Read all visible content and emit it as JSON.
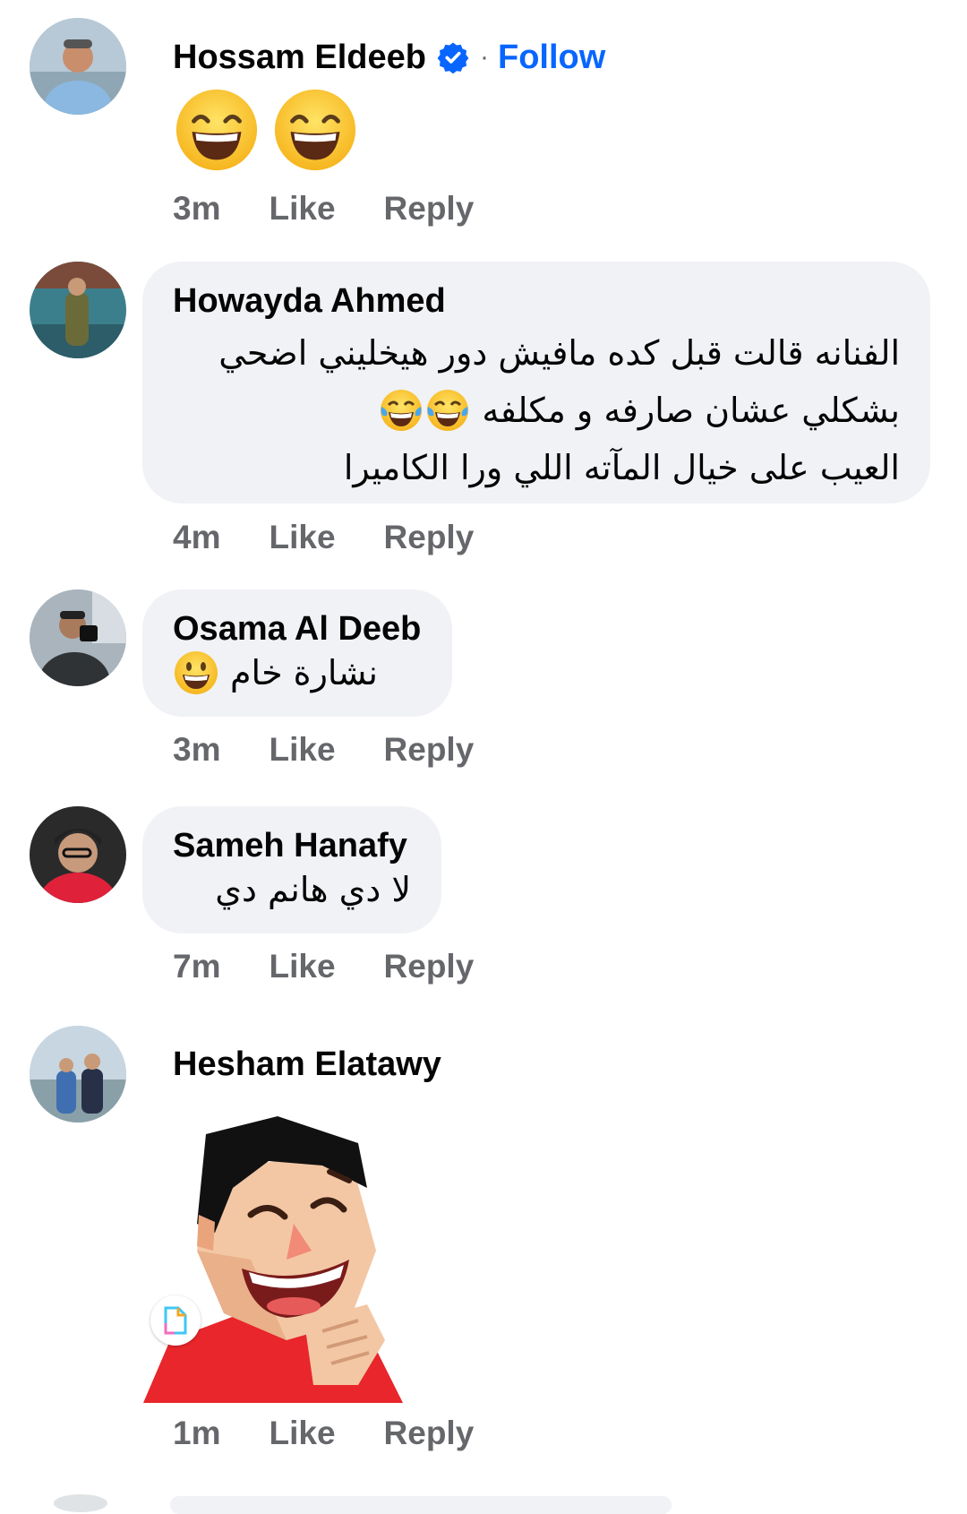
{
  "comments": [
    {
      "author": "Hossam Eldeeb",
      "verified": true,
      "follow_label": "Follow",
      "separator": "·",
      "content_emoji": [
        "grinning-smiling-eyes-emoji",
        "grinning-smiling-eyes-emoji"
      ],
      "time": "3m",
      "like": "Like",
      "reply": "Reply"
    },
    {
      "author": "Howayda Ahmed",
      "lines": [
        "الفنانه قالت قبل كده مافيش دور هيخليني اضحي",
        "بشكلي  عشان صارفه و مكلفه",
        "العيب على خيال المآته اللي ورا الكاميرا"
      ],
      "line_emoji": [
        "tears-of-joy-emoji",
        "tears-of-joy-emoji"
      ],
      "time": "4m",
      "like": "Like",
      "reply": "Reply"
    },
    {
      "author": "Osama Al Deeb",
      "text": "نشارة خام",
      "text_emoji": "grinning-face-emoji",
      "time": "3m",
      "like": "Like",
      "reply": "Reply"
    },
    {
      "author": "Sameh Hanafy",
      "text": "لا دي هانم دي",
      "time": "7m",
      "like": "Like",
      "reply": "Reply"
    },
    {
      "author": "Hesham Elatawy",
      "sticker": "laughing-man-sticker",
      "time": "1m",
      "like": "Like",
      "reply": "Reply"
    }
  ],
  "colors": {
    "bubble": "#f0f2f5",
    "meta_text": "#65676b",
    "follow": "#0866ff",
    "verified": "#0866ff"
  }
}
